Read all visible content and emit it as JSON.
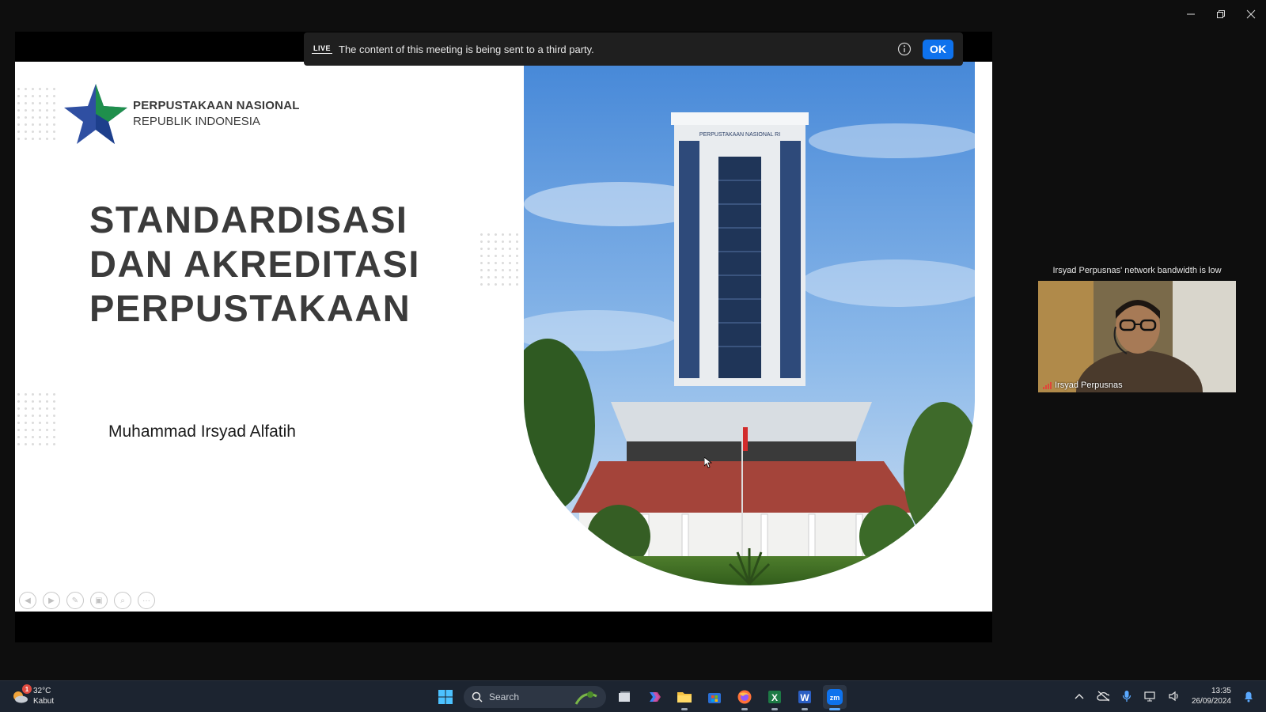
{
  "window": {
    "controls": [
      "minimize",
      "restore",
      "close"
    ]
  },
  "banner": {
    "live_label": "LIVE",
    "text": "The content of this meeting is being sent to a third party.",
    "ok_label": "OK"
  },
  "slide": {
    "logo_line1": "PERPUSTAKAAN NASIONAL",
    "logo_line2": "REPUBLIK INDONESIA",
    "title_lines": [
      "STANDARDISASI",
      "DAN AKREDITASI",
      "PERPUSTAKAAN"
    ],
    "presenter": "Muhammad Irsyad Alfatih",
    "building_sign": "PERPUSTAKAAN NASIONAL RI"
  },
  "video": {
    "bandwidth_note": "Irsyad Perpusnas' network bandwidth is low",
    "participant_name": "Irsyad Perpusnas"
  },
  "taskbar": {
    "weather_temp": "32°C",
    "weather_desc": "Kabut",
    "weather_badge": "1",
    "search_placeholder": "Search",
    "time": "13:35",
    "date": "26/09/2024"
  },
  "colors": {
    "ok_button": "#0e72ed",
    "taskbar": "#1c2430",
    "title_text": "#3b3b3b"
  }
}
